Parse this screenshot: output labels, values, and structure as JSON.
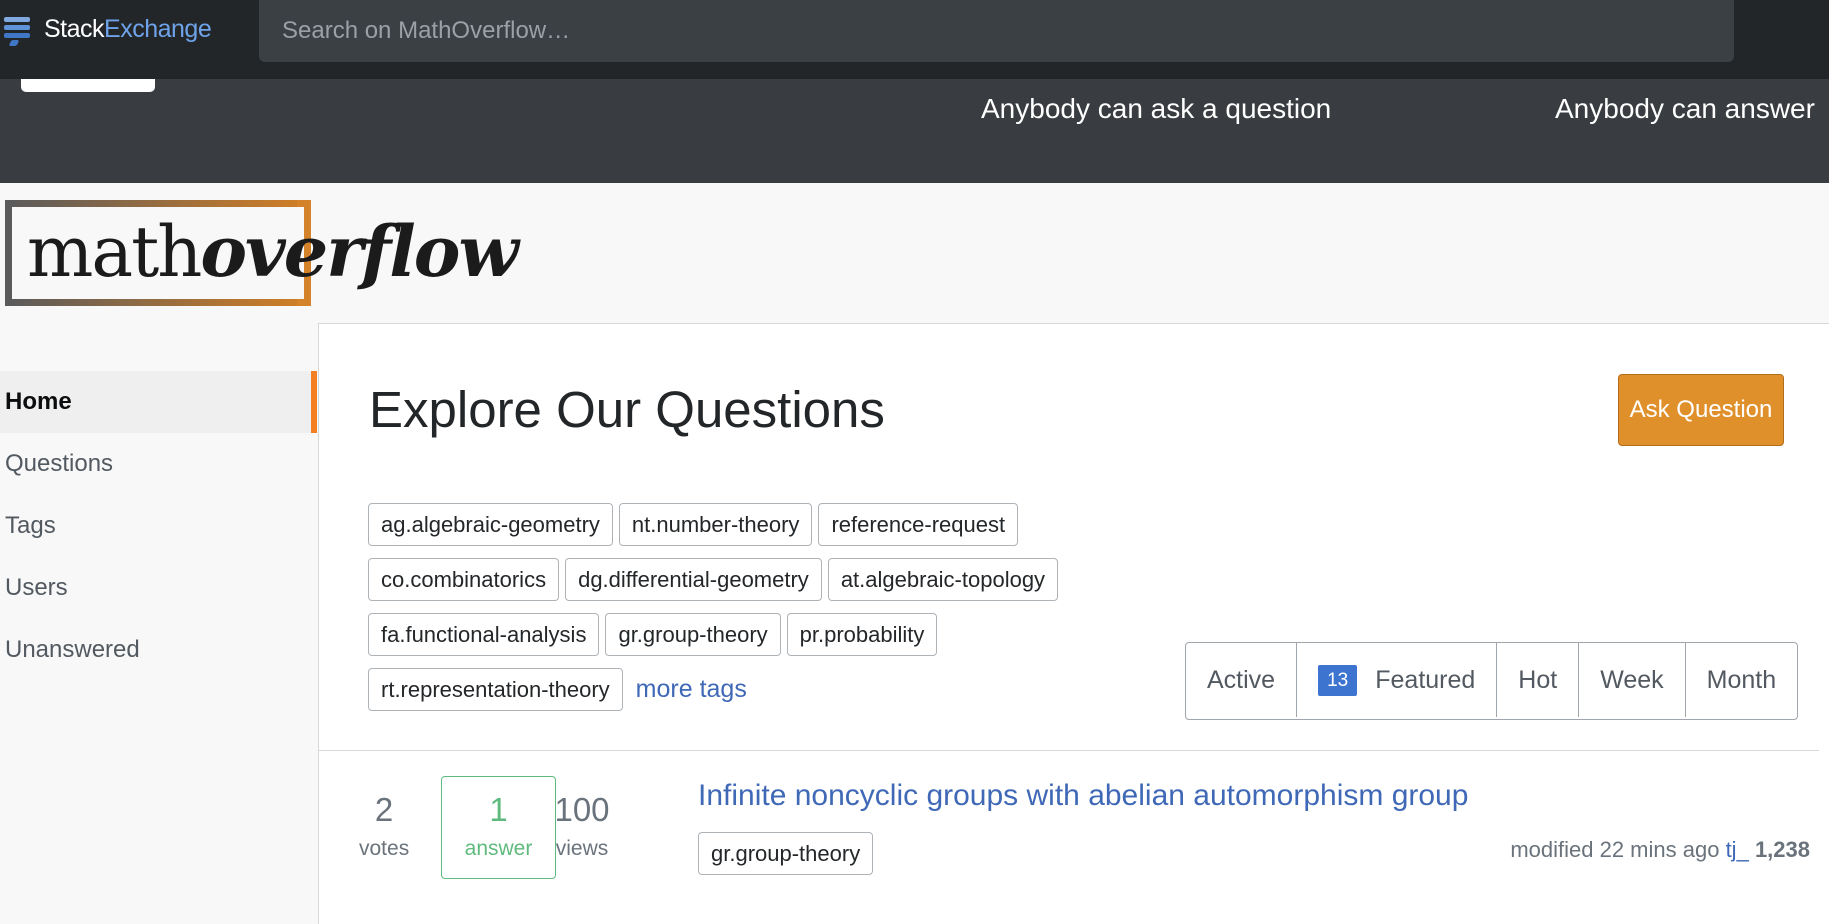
{
  "topbar": {
    "brand_part1": "Stack",
    "brand_part2": "Exchange",
    "search_placeholder": "Search on MathOverflow…"
  },
  "banner": {
    "text1": "Anybody can ask a question",
    "text2": "Anybody can answer"
  },
  "logo": {
    "part1": "math",
    "part2": "overflow"
  },
  "sidebar": {
    "items": [
      {
        "label": "Home",
        "active": true
      },
      {
        "label": "Questions"
      },
      {
        "label": "Tags"
      },
      {
        "label": "Users"
      },
      {
        "label": "Unanswered"
      }
    ]
  },
  "main": {
    "title": "Explore Our Questions",
    "ask_button": "Ask Question",
    "tags": [
      "ag.algebraic-geometry",
      "nt.number-theory",
      "reference-request",
      "co.combinatorics",
      "dg.differential-geometry",
      "at.algebraic-topology",
      "fa.functional-analysis",
      "gr.group-theory",
      "pr.probability",
      "rt.representation-theory"
    ],
    "more_tags": "more tags",
    "filters": {
      "active": "Active",
      "featured_count": "13",
      "featured": "Featured",
      "hot": "Hot",
      "week": "Week",
      "month": "Month"
    }
  },
  "question": {
    "votes": "2",
    "votes_label": "votes",
    "answers": "1",
    "answers_label": "answer",
    "views": "100",
    "views_label": "views",
    "title": "Infinite noncyclic groups with abelian automorphism group",
    "tag": "gr.group-theory",
    "modified": "modified 22 mins ago",
    "user": "tj_",
    "reputation": "1,238"
  },
  "colors": {
    "accent": "#e0902b",
    "link": "#3f68b6",
    "answered": "#5fba7d",
    "topbar": "#232629"
  }
}
